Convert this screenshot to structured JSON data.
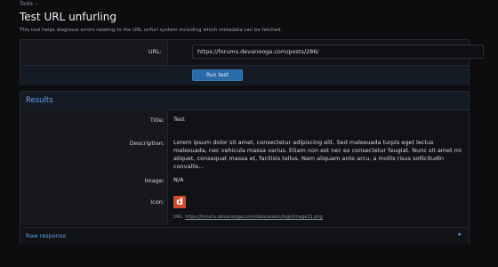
{
  "breadcrumb": {
    "items": [
      "Tools"
    ],
    "separator": "›"
  },
  "page": {
    "title": "Test URL unfurling",
    "description": "This tool helps diagnose errors relating to the URL unfurl system including which metadata can be fetched."
  },
  "form": {
    "url_label": "URL:",
    "url_value": "https://forums.devanooga.com/posts/286/",
    "run_button": "Run test"
  },
  "results": {
    "title": "Results",
    "title_label": "Title:",
    "title_value": "Test",
    "description_label": "Description:",
    "description_value": "Lorem ipsum dolor sit amet, consectetur adipiscing elit. Sed malesuada turpis eget lectus malesuada, nec vehicula massa varius. Etiam non est nec ex consectetur feugiat. Nunc sit amet mi aliquet, consequat massa et, facilisis tellus. Nam aliquam ante arcu, a mollis risus sollicitudin convallis...",
    "image_label": "Image:",
    "image_value": "N/A",
    "icon_label": "Icon:",
    "icon_glyph": "d",
    "icon_url_prefix": "URL:",
    "icon_url": "https://forums.devanooga.com/data/assets/logo/image11.png",
    "raw_response": "Raw response"
  },
  "colors": {
    "accent": "#5fa0e0",
    "button": "#2b6aa8",
    "icon_bg": "#d24a2c"
  }
}
